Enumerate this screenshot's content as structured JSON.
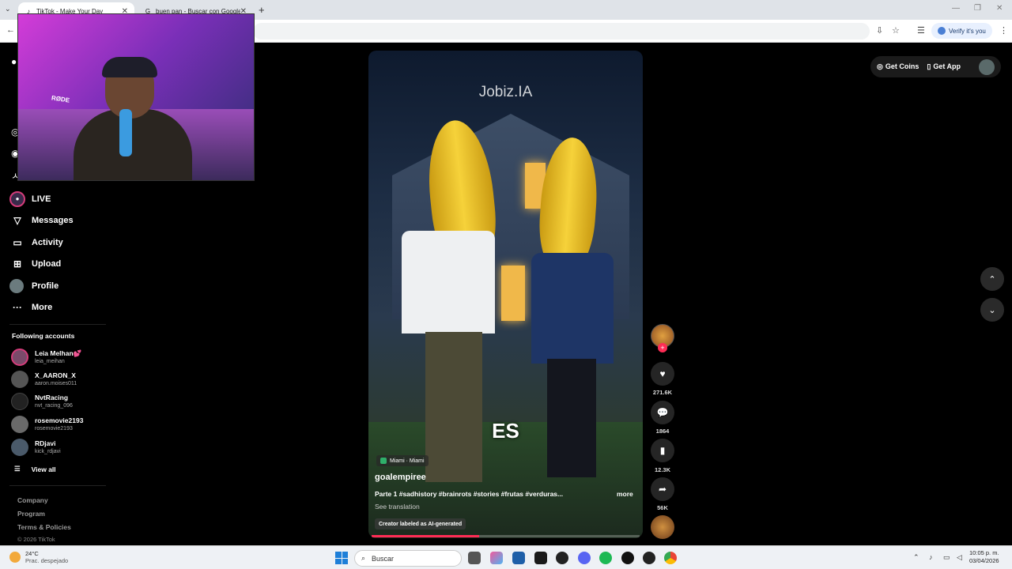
{
  "browser": {
    "tabs": [
      {
        "title": "TikTok - Make Your Day",
        "active": true
      },
      {
        "title": "buen pan - Buscar con Google",
        "active": false
      }
    ],
    "verify_label": "Verify it's you"
  },
  "webcam": {
    "mic_brand": "RØDE"
  },
  "nav": {
    "items": [
      {
        "label": "LIVE",
        "icon": "live-icon"
      },
      {
        "label": "Messages",
        "icon": "paper-plane-icon"
      },
      {
        "label": "Activity",
        "icon": "activity-icon"
      },
      {
        "label": "Upload",
        "icon": "plus-square-icon"
      },
      {
        "label": "Profile",
        "icon": "avatar"
      },
      {
        "label": "More",
        "icon": "more-dots-icon"
      }
    ]
  },
  "following": {
    "title": "Following accounts",
    "accounts": [
      {
        "name": "Leia Melhan💕",
        "handle": "leia_meihan"
      },
      {
        "name": "X_AARON_X",
        "handle": "aaron.moises011"
      },
      {
        "name": "NvtRacing",
        "handle": "nvt_racing_096"
      },
      {
        "name": "rosemovie2193",
        "handle": "rosemovie2193"
      },
      {
        "name": "RDjavi",
        "handle": "kick_rdjavi"
      }
    ],
    "view_all": "View all"
  },
  "footer": {
    "links": [
      "Company",
      "Program",
      "Terms & Policies"
    ],
    "copyright": "© 2026 TikTok"
  },
  "video": {
    "watermark": "Jobiz.IA",
    "caption": "ES",
    "location": "Miami · Miami",
    "author": "goalempiree",
    "description": "Parte 1 #sadhistory #brainrots #stories #frutas #verduras...",
    "more": "more",
    "see_translation": "See translation",
    "ai_label": "Creator labeled as AI-generated",
    "progress": 0.4
  },
  "actions": {
    "likes": "271.6K",
    "comments": "1864",
    "saves": "12.3K",
    "shares": "56K"
  },
  "topright": {
    "get_coins": "Get Coins",
    "get_app": "Get App"
  },
  "taskbar": {
    "temp": "24°C",
    "weather": "Prac. despejado",
    "search": "Buscar",
    "time": "10:05 p. m.",
    "date": "03/04/2026"
  }
}
